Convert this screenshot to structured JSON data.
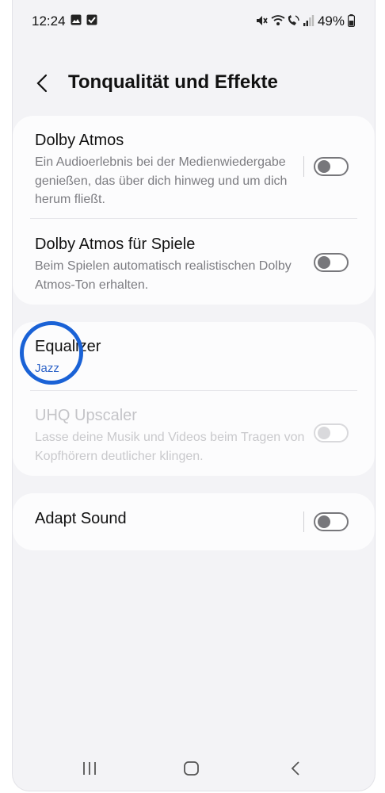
{
  "status_bar": {
    "time": "12:24",
    "left_icons": [
      "gallery-icon",
      "checkbox-icon"
    ],
    "right_icons": [
      "mute-icon",
      "wifi-call-icon",
      "signal-icon"
    ],
    "battery": "49%"
  },
  "header": {
    "back_icon": "back-arrow-icon",
    "title": "Tonqualität und Effekte"
  },
  "settings": {
    "dolby_atmos": {
      "title": "Dolby Atmos",
      "description": "Ein Audioerlebnis bei der Medienwiedergabe genießen, das über dich hinweg und um dich herum fließt.",
      "enabled": false
    },
    "dolby_atmos_games": {
      "title": "Dolby Atmos für Spiele",
      "description": "Beim Spielen automatisch realistischen Dolby Atmos-Ton erhalten.",
      "enabled": false
    },
    "equalizer": {
      "title": "Equalizer",
      "value": "Jazz"
    },
    "uhq_upscaler": {
      "title": "UHQ Upscaler",
      "description": "Lasse deine Musik und Videos beim Tragen von Kopfhörern deutlicher klingen.",
      "enabled": false,
      "disabled_state": true
    },
    "adapt_sound": {
      "title": "Adapt Sound",
      "enabled": false
    }
  },
  "annotation": {
    "highlight_color": "#1a62d6",
    "highlight_target": "equalizer"
  },
  "nav_bar": {
    "icons": [
      "recents-icon",
      "home-icon",
      "back-icon"
    ]
  },
  "colors": {
    "accent": "#2d63c8",
    "background": "#f3f3f6",
    "card": "#fcfcfd"
  }
}
